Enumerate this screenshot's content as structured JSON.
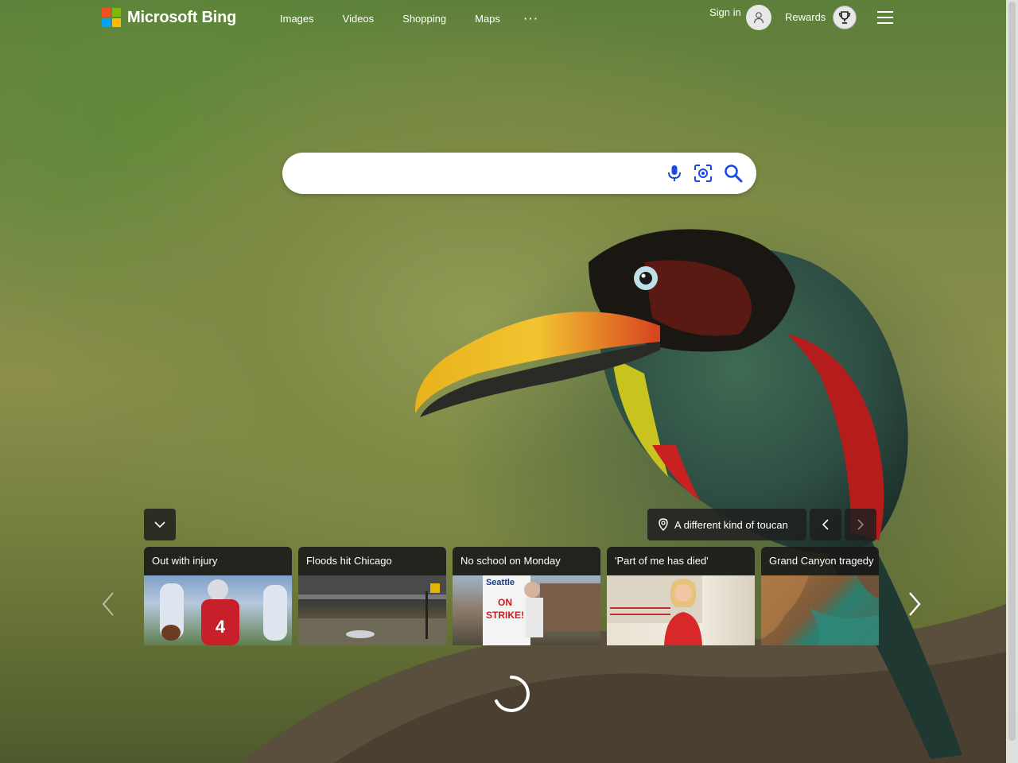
{
  "brand": {
    "name": "Microsoft Bing",
    "logo_colors": [
      "#f25022",
      "#7fba00",
      "#00a4ef",
      "#ffb900"
    ]
  },
  "nav": {
    "items": [
      "Images",
      "Videos",
      "Shopping",
      "Maps"
    ],
    "more": "···"
  },
  "account": {
    "signin_label": "Sign in",
    "rewards_label": "Rewards"
  },
  "search": {
    "value": "",
    "placeholder": ""
  },
  "image_info": {
    "title": "A different kind of toucan"
  },
  "trending": [
    {
      "title": "Out with injury"
    },
    {
      "title": "Floods hit Chicago"
    },
    {
      "title": "No school on Monday"
    },
    {
      "title": "'Part of me has died'"
    },
    {
      "title": "Grand Canyon tragedy"
    }
  ],
  "strike_sign": {
    "line1": "Seattle",
    "line2": "ON",
    "line3": "STRIKE!"
  },
  "player_number": "4"
}
